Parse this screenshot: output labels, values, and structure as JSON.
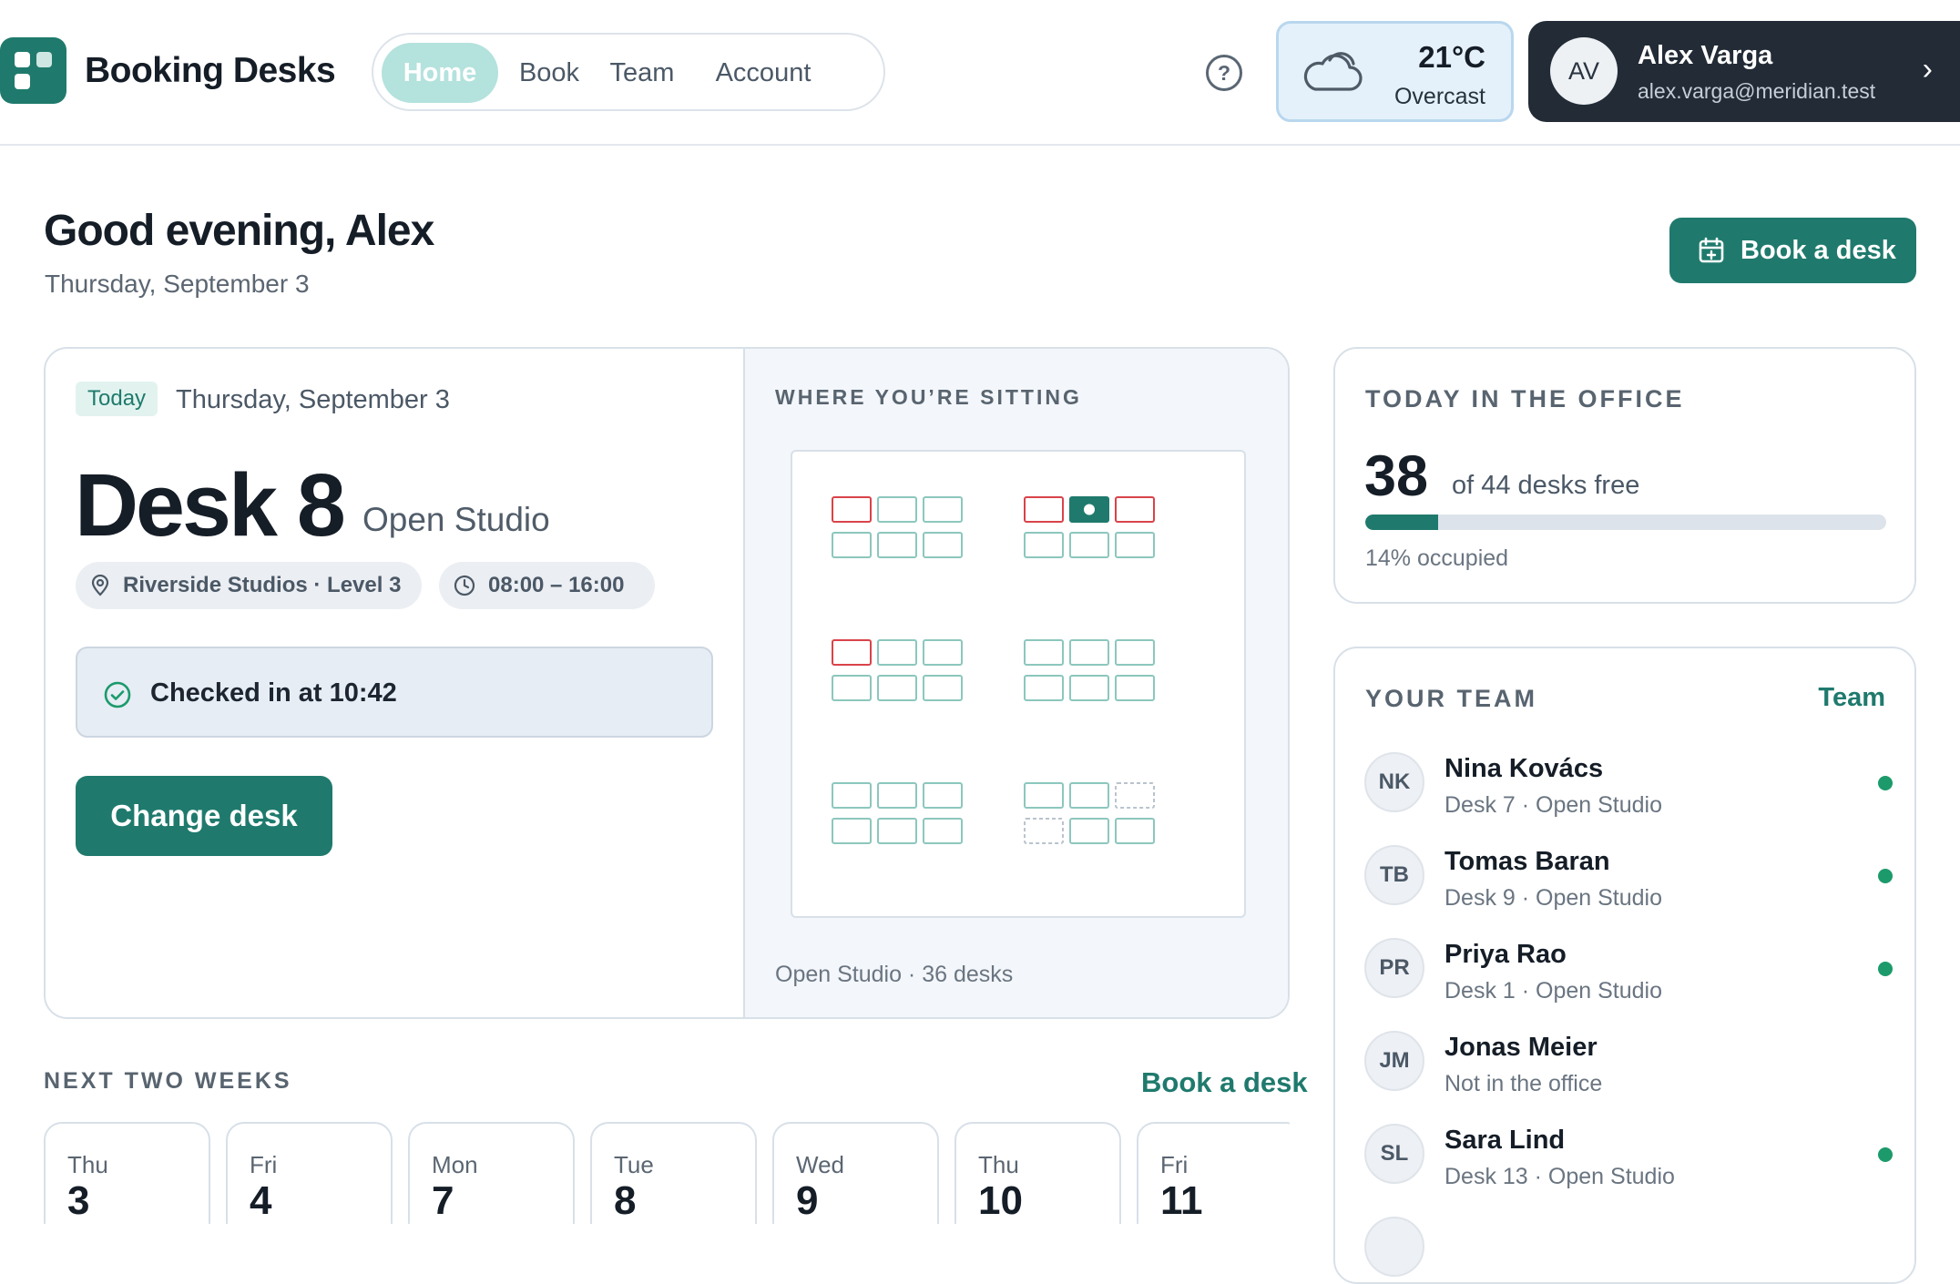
{
  "app": {
    "name": "Booking Desks"
  },
  "nav": {
    "items": [
      "Home",
      "Book",
      "Team",
      "Account"
    ],
    "active": "Home"
  },
  "weather": {
    "temp": "21°C",
    "condition": "Overcast",
    "icon": "cloud-icon"
  },
  "user": {
    "initials": "AV",
    "name": "Alex Varga",
    "email": "alex.varga@meridian.test"
  },
  "greeting": {
    "title": "Good evening, Alex",
    "date": "Thursday, September 3"
  },
  "actions": {
    "book_desk": "Book a desk",
    "change_desk": "Change desk"
  },
  "booking": {
    "badge": "Today",
    "date": "Thursday, September 3",
    "desk": "Desk 8",
    "zone": "Open Studio",
    "location": "Riverside Studios · Level 3",
    "time": "08:00 – 16:00",
    "status": "Checked in at 10:42"
  },
  "floorplan": {
    "label": "WHERE YOU’RE SITTING",
    "caption": "Open Studio · 36 desks",
    "colors": {
      "free": "#8cc7bd",
      "occupied": "#d9434a",
      "mine": "#1f7a6d",
      "unavailable": "#b9c3cd"
    },
    "clusters": [
      [
        "occupied",
        "free",
        "free",
        "free",
        "free",
        "free"
      ],
      [
        "occupied",
        "mine",
        "occupied",
        "free",
        "free",
        "free"
      ],
      [
        "occupied",
        "free",
        "free",
        "free",
        "free",
        "free"
      ],
      [
        "free",
        "free",
        "free",
        "free",
        "free",
        "free"
      ],
      [
        "free",
        "free",
        "free",
        "free",
        "free",
        "free"
      ],
      [
        "free",
        "free",
        "unavailable",
        "unavailable",
        "free",
        "free"
      ]
    ]
  },
  "next_weeks": {
    "label": "NEXT TWO WEEKS",
    "link": "Book a desk",
    "days": [
      {
        "name": "Thu",
        "num": "3",
        "selected": true
      },
      {
        "name": "Fri",
        "num": "4"
      },
      {
        "name": "Mon",
        "num": "7"
      },
      {
        "name": "Tue",
        "num": "8"
      },
      {
        "name": "Wed",
        "num": "9"
      },
      {
        "name": "Thu",
        "num": "10"
      },
      {
        "name": "Fri",
        "num": "11"
      }
    ]
  },
  "office": {
    "label": "TODAY IN THE OFFICE",
    "free": "38",
    "free_text": "of 44 desks free",
    "occupied_pct": 14,
    "occupied_text": "14% occupied"
  },
  "team": {
    "label": "YOUR TEAM",
    "link": "Team",
    "members": [
      {
        "initials": "NK",
        "name": "Nina Kovács",
        "desk": "Desk 7 · Open Studio",
        "present": true
      },
      {
        "initials": "TB",
        "name": "Tomas Baran",
        "desk": "Desk 9 · Open Studio",
        "present": true
      },
      {
        "initials": "PR",
        "name": "Priya Rao",
        "desk": "Desk 1 · Open Studio",
        "present": true
      },
      {
        "initials": "JM",
        "name": "Jonas Meier",
        "desk": "Not in the office",
        "present": false
      },
      {
        "initials": "SL",
        "name": "Sara Lind",
        "desk": "Desk 13 · Open Studio",
        "present": true
      }
    ]
  }
}
